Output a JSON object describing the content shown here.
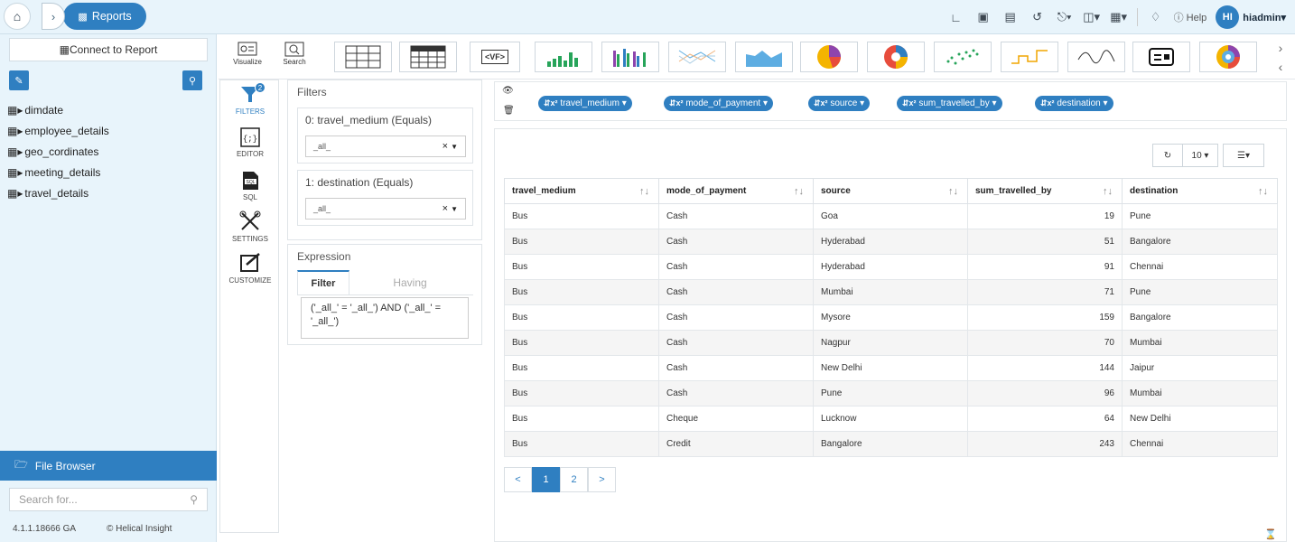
{
  "app": {
    "breadcrumb_label": "Reports",
    "user": "hiadmin",
    "user_initials": "HI",
    "help_label": "Help",
    "accent": "#2f7fc1"
  },
  "sidebar": {
    "connect_label": "Connect to Report",
    "items": [
      {
        "label": "dimdate"
      },
      {
        "label": "employee_details"
      },
      {
        "label": "geo_cordinates"
      },
      {
        "label": "meeting_details"
      },
      {
        "label": "travel_details"
      }
    ],
    "file_browser_label": "File Browser",
    "search_placeholder": "Search for...",
    "version": "4.1.1.18666 GA",
    "copyright": "© Helical Insight"
  },
  "toolbar": {
    "visualize_label": "Visualize",
    "search_label": "Search",
    "vf_label": "<VF>"
  },
  "sidetabs": {
    "filters_label": "FILTERS",
    "filters_badge": "2",
    "editor_label": "EDITOR",
    "sql_label": "SQL",
    "settings_label": "SETTINGS",
    "customize_label": "CUSTOMIZE"
  },
  "filters": {
    "title": "Filters",
    "items": [
      {
        "label": "0: travel_medium (Equals)",
        "value": "_all_"
      },
      {
        "label": "1: destination (Equals)",
        "value": "_all_"
      }
    ]
  },
  "expression": {
    "title": "Expression",
    "tab_filter": "Filter",
    "tab_having": "Having",
    "text": "('_all_' = '_all_') AND ('_all_' = '_all_')"
  },
  "fields": [
    "travel_medium",
    "mode_of_payment",
    "source",
    "sum_travelled_by",
    "destination"
  ],
  "table": {
    "page_size": "10",
    "columns": [
      "travel_medium",
      "mode_of_payment",
      "source",
      "sum_travelled_by",
      "destination"
    ],
    "rows": [
      [
        "Bus",
        "Cash",
        "Goa",
        "19",
        "Pune"
      ],
      [
        "Bus",
        "Cash",
        "Hyderabad",
        "51",
        "Bangalore"
      ],
      [
        "Bus",
        "Cash",
        "Hyderabad",
        "91",
        "Chennai"
      ],
      [
        "Bus",
        "Cash",
        "Mumbai",
        "71",
        "Pune"
      ],
      [
        "Bus",
        "Cash",
        "Mysore",
        "159",
        "Bangalore"
      ],
      [
        "Bus",
        "Cash",
        "Nagpur",
        "70",
        "Mumbai"
      ],
      [
        "Bus",
        "Cash",
        "New Delhi",
        "144",
        "Jaipur"
      ],
      [
        "Bus",
        "Cash",
        "Pune",
        "96",
        "Mumbai"
      ],
      [
        "Bus",
        "Cheque",
        "Lucknow",
        "64",
        "New Delhi"
      ],
      [
        "Bus",
        "Credit",
        "Bangalore",
        "243",
        "Chennai"
      ]
    ],
    "pagination": {
      "prev": "<",
      "pages": [
        "1",
        "2"
      ],
      "active": "1",
      "next": ">"
    }
  }
}
